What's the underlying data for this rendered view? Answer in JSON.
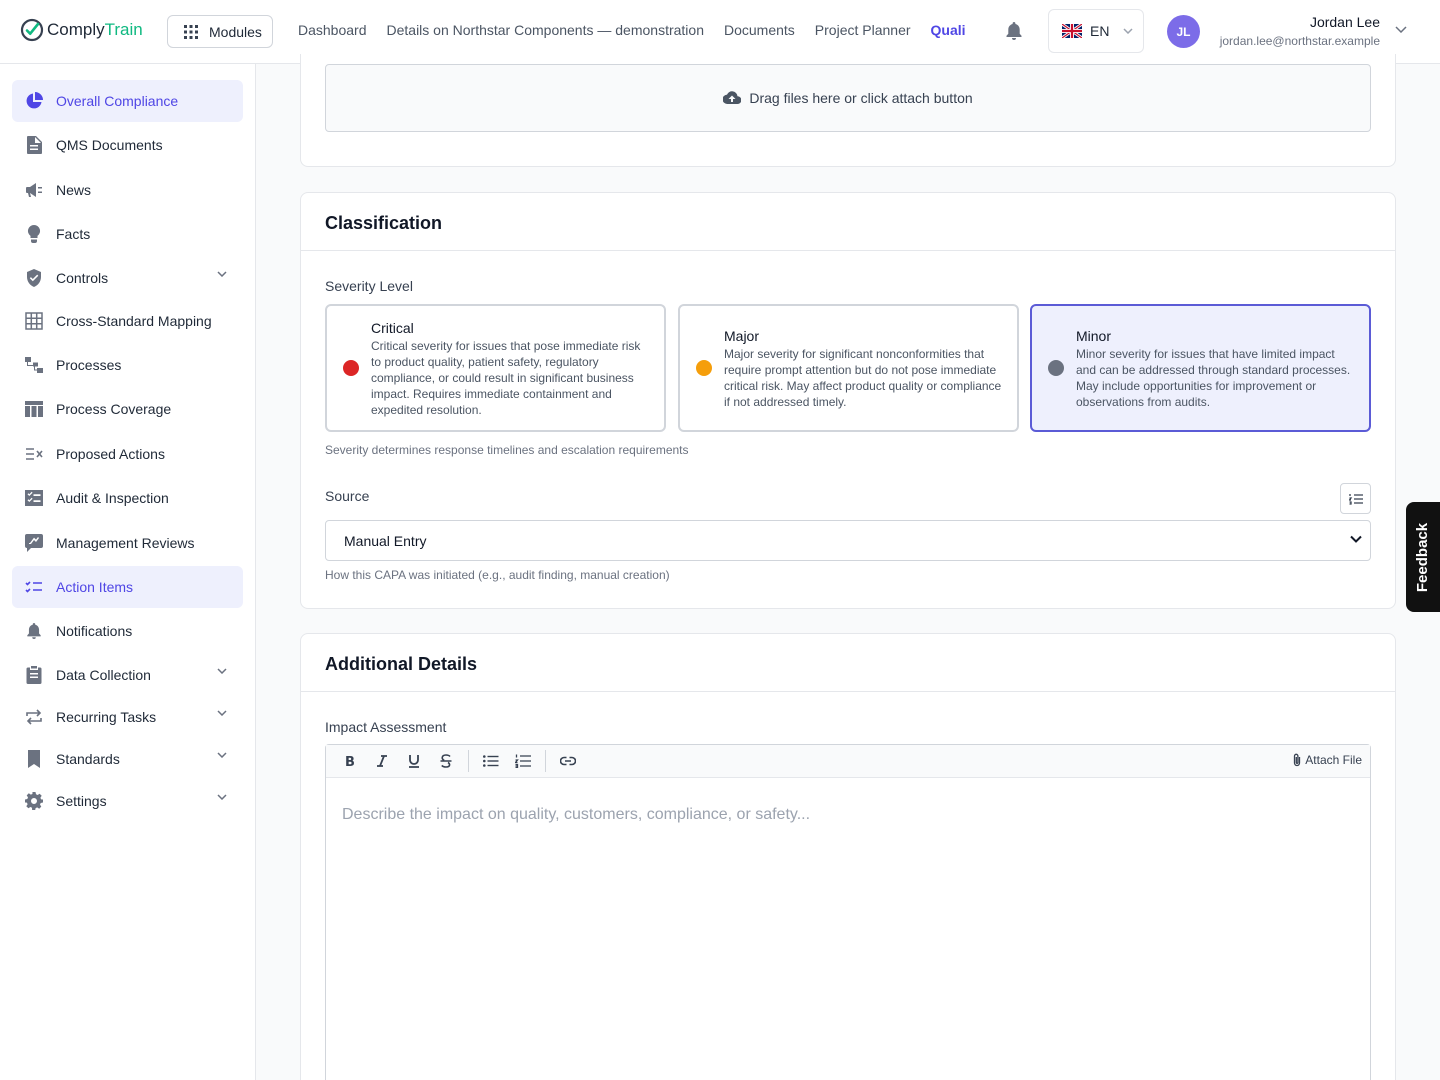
{
  "header": {
    "logo": {
      "part1": "Comply",
      "part2": "Train"
    },
    "modules_label": "Modules",
    "nav": [
      "Dashboard",
      "Details on Northstar Components — demonstration",
      "Documents",
      "Project Planner",
      "Quali"
    ],
    "language": "EN",
    "user": {
      "initials": "JL",
      "name": "Jordan Lee",
      "email": "jordan.lee@northstar.example"
    }
  },
  "sidebar": {
    "items": [
      {
        "label": "Overall Compliance",
        "icon": "pie-chart-icon",
        "active": true
      },
      {
        "label": "QMS Documents",
        "icon": "document-icon"
      },
      {
        "label": "News",
        "icon": "megaphone-icon"
      },
      {
        "label": "Facts",
        "icon": "lightbulb-icon"
      },
      {
        "label": "Controls",
        "icon": "shield-icon",
        "expandable": true
      },
      {
        "label": "Cross-Standard Mapping",
        "icon": "grid-icon"
      },
      {
        "label": "Processes",
        "icon": "process-icon"
      },
      {
        "label": "Process Coverage",
        "icon": "table-icon"
      },
      {
        "label": "Proposed Actions",
        "icon": "list-x-icon"
      },
      {
        "label": "Audit & Inspection",
        "icon": "checklist-icon"
      },
      {
        "label": "Management Reviews",
        "icon": "chart-icon"
      },
      {
        "label": "Action Items",
        "icon": "list-check-icon",
        "active": true
      },
      {
        "label": "Notifications",
        "icon": "bell-icon"
      },
      {
        "label": "Data Collection",
        "icon": "clipboard-icon",
        "expandable": true
      },
      {
        "label": "Recurring Tasks",
        "icon": "repeat-icon",
        "expandable": true
      },
      {
        "label": "Standards",
        "icon": "bookmark-icon",
        "expandable": true
      },
      {
        "label": "Settings",
        "icon": "gear-icon",
        "expandable": true
      }
    ]
  },
  "upload": {
    "dropzone_text": "Drag files here or click attach button"
  },
  "classification": {
    "title": "Classification",
    "severity_label": "Severity Level",
    "severity_helper": "Severity determines response timelines and escalation requirements",
    "options": [
      {
        "title": "Critical",
        "color": "#dc2626",
        "desc": "Critical severity for issues that pose immediate risk to product quality, patient safety, regulatory compliance, or could result in significant business impact. Requires immediate containment and expedited resolution."
      },
      {
        "title": "Major",
        "color": "#f59e0b",
        "desc": "Major severity for significant nonconformities that require prompt attention but do not pose immediate critical risk. May affect product quality or compliance if not addressed timely."
      },
      {
        "title": "Minor",
        "color": "#6b7280",
        "desc": "Minor severity for issues that have limited impact and can be addressed through standard processes. May include opportunities for improvement or observations from audits.",
        "selected": true
      }
    ],
    "source_label": "Source",
    "source_value": "Manual Entry",
    "source_helper": "How this CAPA was initiated (e.g., audit finding, manual creation)"
  },
  "details": {
    "title": "Additional Details",
    "impact_label": "Impact Assessment",
    "attach_label": "Attach File",
    "impact_placeholder": "Describe the impact on quality, customers, compliance, or safety..."
  },
  "feedback_label": "Feedback",
  "colors": {
    "accent": "#4f46e5",
    "active_bg": "#eef0fd",
    "brand_green": "#10b981"
  }
}
